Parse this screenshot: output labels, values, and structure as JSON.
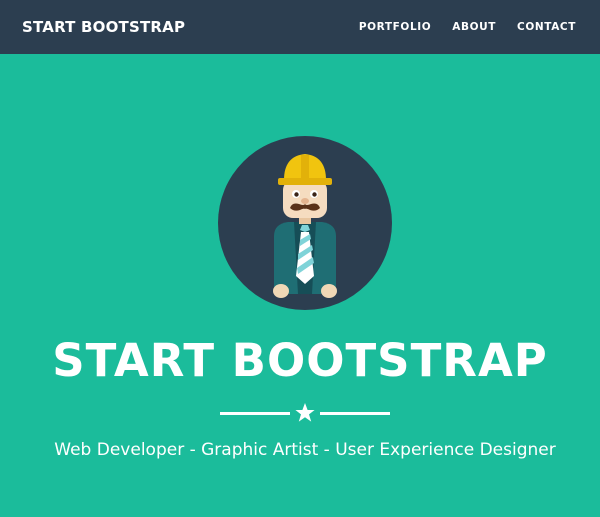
{
  "navbar": {
    "brand": "START BOOTSTRAP",
    "links": [
      "PORTFOLIO",
      "ABOUT",
      "CONTACT"
    ]
  },
  "hero": {
    "title": "START BOOTSTRAP",
    "tagline": "Web Developer - Graphic Artist - User Experience Designer",
    "avatar_icon": "profile-avatar-icon",
    "divider_icon": "star-icon"
  },
  "colors": {
    "navbar_bg": "#2c3e50",
    "hero_bg": "#1bbc9b",
    "text": "#ffffff",
    "avatar_circle": "#2c3e50",
    "hat": "#f1c40f"
  }
}
